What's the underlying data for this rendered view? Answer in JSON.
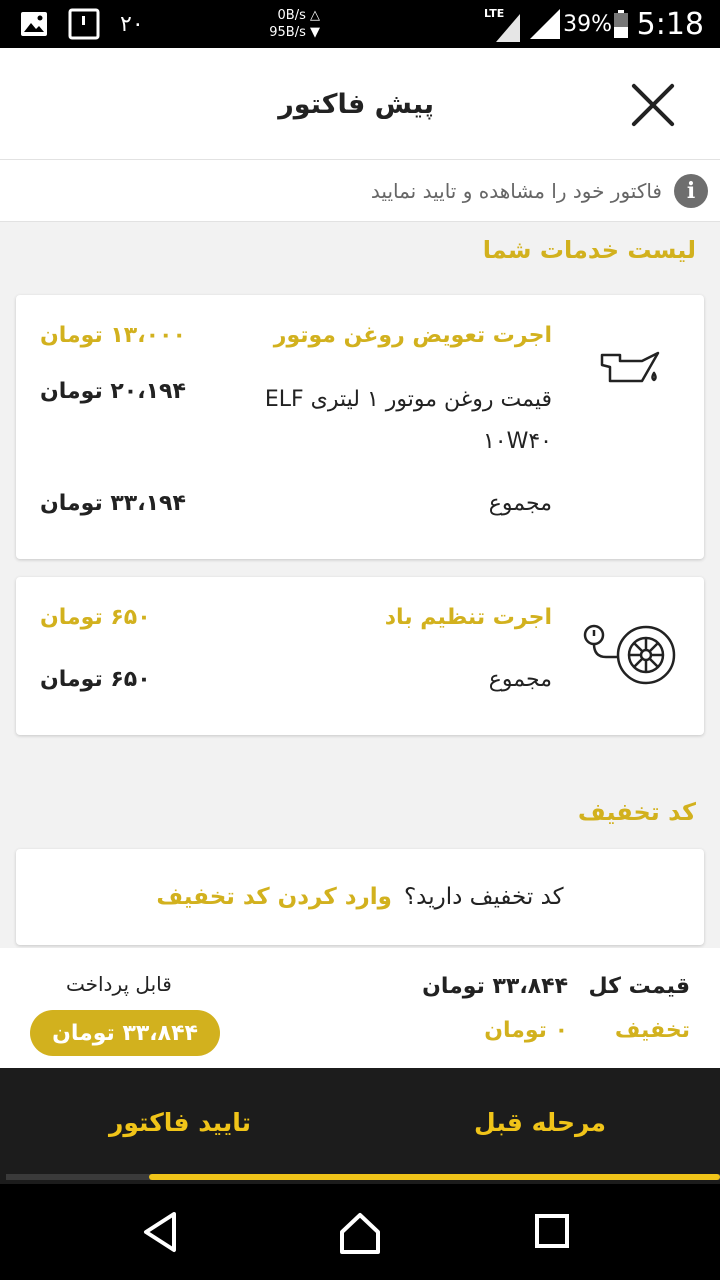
{
  "status_bar": {
    "notif_number": "۲۰",
    "net_up": "0B/s",
    "net_down": "95B/s",
    "network_type": "LTE",
    "battery": "39%",
    "time": "5:18"
  },
  "header": {
    "title": "پیش فاکتور"
  },
  "info": {
    "text": "فاکتور خود را مشاهده و تایید نمایید",
    "icon": "info-icon"
  },
  "services": {
    "title": "لیست خدمات شما",
    "cards": [
      {
        "icon": "oil-can-icon",
        "lines": [
          {
            "label": "اجرت تعویض روغن موتور",
            "value": "۱۳،۰۰۰ تومان"
          },
          {
            "label": "قیمت روغن موتور ۱ لیتری ELF ۱۰W۴۰",
            "value": "۲۰،۱۹۴ تومان"
          }
        ],
        "total_label": "مجموع",
        "total_value": "۳۳،۱۹۴ تومان"
      },
      {
        "icon": "tire-pressure-icon",
        "lines": [
          {
            "label": "اجرت تنظیم باد",
            "value": "۶۵۰ تومان"
          }
        ],
        "total_label": "مجموع",
        "total_value": "۶۵۰ تومان"
      }
    ]
  },
  "discount": {
    "title": "کد تخفیف",
    "question": "کد تخفیف دارید؟",
    "link": "وارد کردن کد تخفیف"
  },
  "summary": {
    "total_label": "قیمت کل",
    "total_value": "۳۳،۸۴۴ تومان",
    "discount_label": "تخفیف",
    "discount_value": "۰ تومان",
    "payable_label": "قابل پرداخت",
    "payable_value": "۳۳،۸۴۴ تومان"
  },
  "actions": {
    "prev_label": "مرحله قبل",
    "confirm_label": "تایید فاکتور",
    "progress": 0.8
  },
  "colors": {
    "accent": "#d2b11e",
    "action_text": "#f0c419",
    "action_bar": "#1c1c1c"
  }
}
